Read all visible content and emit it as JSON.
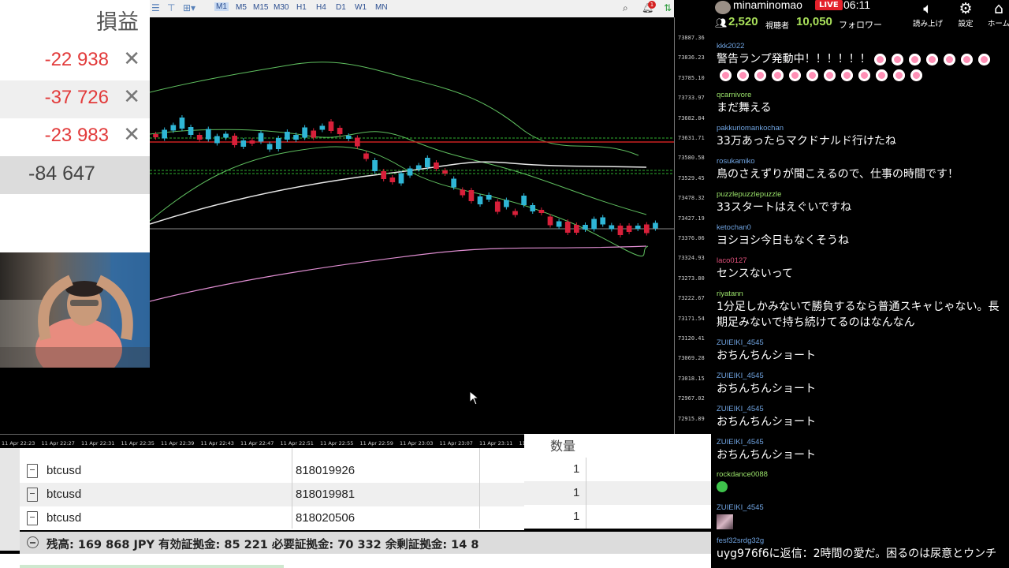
{
  "pl_panel": {
    "header": "損益",
    "rows": [
      {
        "value": "-22 938",
        "close": "✕"
      },
      {
        "value": "-37 726",
        "close": "✕"
      },
      {
        "value": "-23 983",
        "close": "✕"
      }
    ],
    "total": "-84 647"
  },
  "chart": {
    "timeframes": [
      "M1",
      "M5",
      "M15",
      "M30",
      "H1",
      "H4",
      "D1",
      "W1",
      "MN"
    ],
    "active_timeframe": "M1",
    "alert_count": "1",
    "price_labels": [
      "73887.36",
      "73836.23",
      "73785.10",
      "73733.97",
      "73682.84",
      "73631.71",
      "73580.58",
      "73529.45",
      "73478.32",
      "73427.19",
      "73376.06",
      "73324.93",
      "73273.80",
      "73222.67",
      "73171.54",
      "73120.41",
      "73069.28",
      "73018.15",
      "72967.02",
      "72915.89"
    ],
    "time_labels": [
      "11 Apr 22:23",
      "11 Apr 22:27",
      "11 Apr 22:31",
      "11 Apr 22:35",
      "11 Apr 22:39",
      "11 Apr 22:43",
      "11 Apr 22:47",
      "11 Apr 22:51",
      "11 Apr 22:55",
      "11 Apr 22:59",
      "11 Apr 23:03",
      "11 Apr 23:07",
      "11 Apr 23:11",
      "11 Apr"
    ]
  },
  "trades": {
    "columns_visible": [
      "数量"
    ],
    "rows": [
      {
        "symbol": "btcusd",
        "ticket": "818019926",
        "qty": "1"
      },
      {
        "symbol": "btcusd",
        "ticket": "818019981",
        "qty": "1"
      },
      {
        "symbol": "btcusd",
        "ticket": "818020506",
        "qty": "1"
      }
    ],
    "balance_line": "残高: 169 868 JPY  有効証拠金: 85 221  必要証拠金: 70 332  余剰証拠金: 14 8"
  },
  "stream": {
    "username": "minaminomao",
    "live": "LIVE",
    "time": "06:11",
    "viewers": "2,520",
    "viewers_label": "視聴者",
    "followers": "10,050",
    "followers_label": "フォロワー",
    "buttons": [
      {
        "label": "読み上げ",
        "icon": "speaker-icon"
      },
      {
        "label": "設定",
        "icon": "gear-icon"
      },
      {
        "label": "ホーム",
        "icon": "home-icon"
      }
    ],
    "user_colors": {
      "blue": "#6fa3e0",
      "green": "#9be36a",
      "pink": "#e0507a",
      "grey": "#c9c9c9"
    }
  },
  "chat": [
    {
      "user": "kkk2022",
      "text": "警告ランプ発動中！！！！！！",
      "emoji": 19
    },
    {
      "user": "qcarnivore",
      "text": "まだ舞える"
    },
    {
      "user": "pakkuriomankochan",
      "text": "33万あったらマクドナルド行けたね"
    },
    {
      "user": "rosukamiko",
      "text": "鳥のさえずりが聞こえるので、仕事の時間です！"
    },
    {
      "user": "puzzlepuzzlepuzzle",
      "text": "33スタートはえぐいですね"
    },
    {
      "user": "ketochan0",
      "text": "ヨシヨシ今日もなくそうね"
    },
    {
      "user": "laco0127",
      "text": "センスないって"
    },
    {
      "user": "riyatann",
      "text": "1分足しかみないで勝負するなら普通スキャじゃない。長期足みないで持ち続けてるのはなんなん"
    },
    {
      "user": "ZUIEIKI_4545",
      "text": "おちんちんショート"
    },
    {
      "user": "ZUIEIKI_4545",
      "text": "おちんちんショート"
    },
    {
      "user": "ZUIEIKI_4545",
      "text": "おちんちんショート"
    },
    {
      "user": "ZUIEIKI_4545",
      "text": "おちんちんショート"
    },
    {
      "user": "rockdance0088",
      "text": ""
    },
    {
      "user": "ZUIEIKI_4545",
      "text": ""
    },
    {
      "user": "fesf32srdg32g",
      "text": "uyg976f6に返信：2時間の愛だ。困るのは尿意とウンチ"
    }
  ]
}
